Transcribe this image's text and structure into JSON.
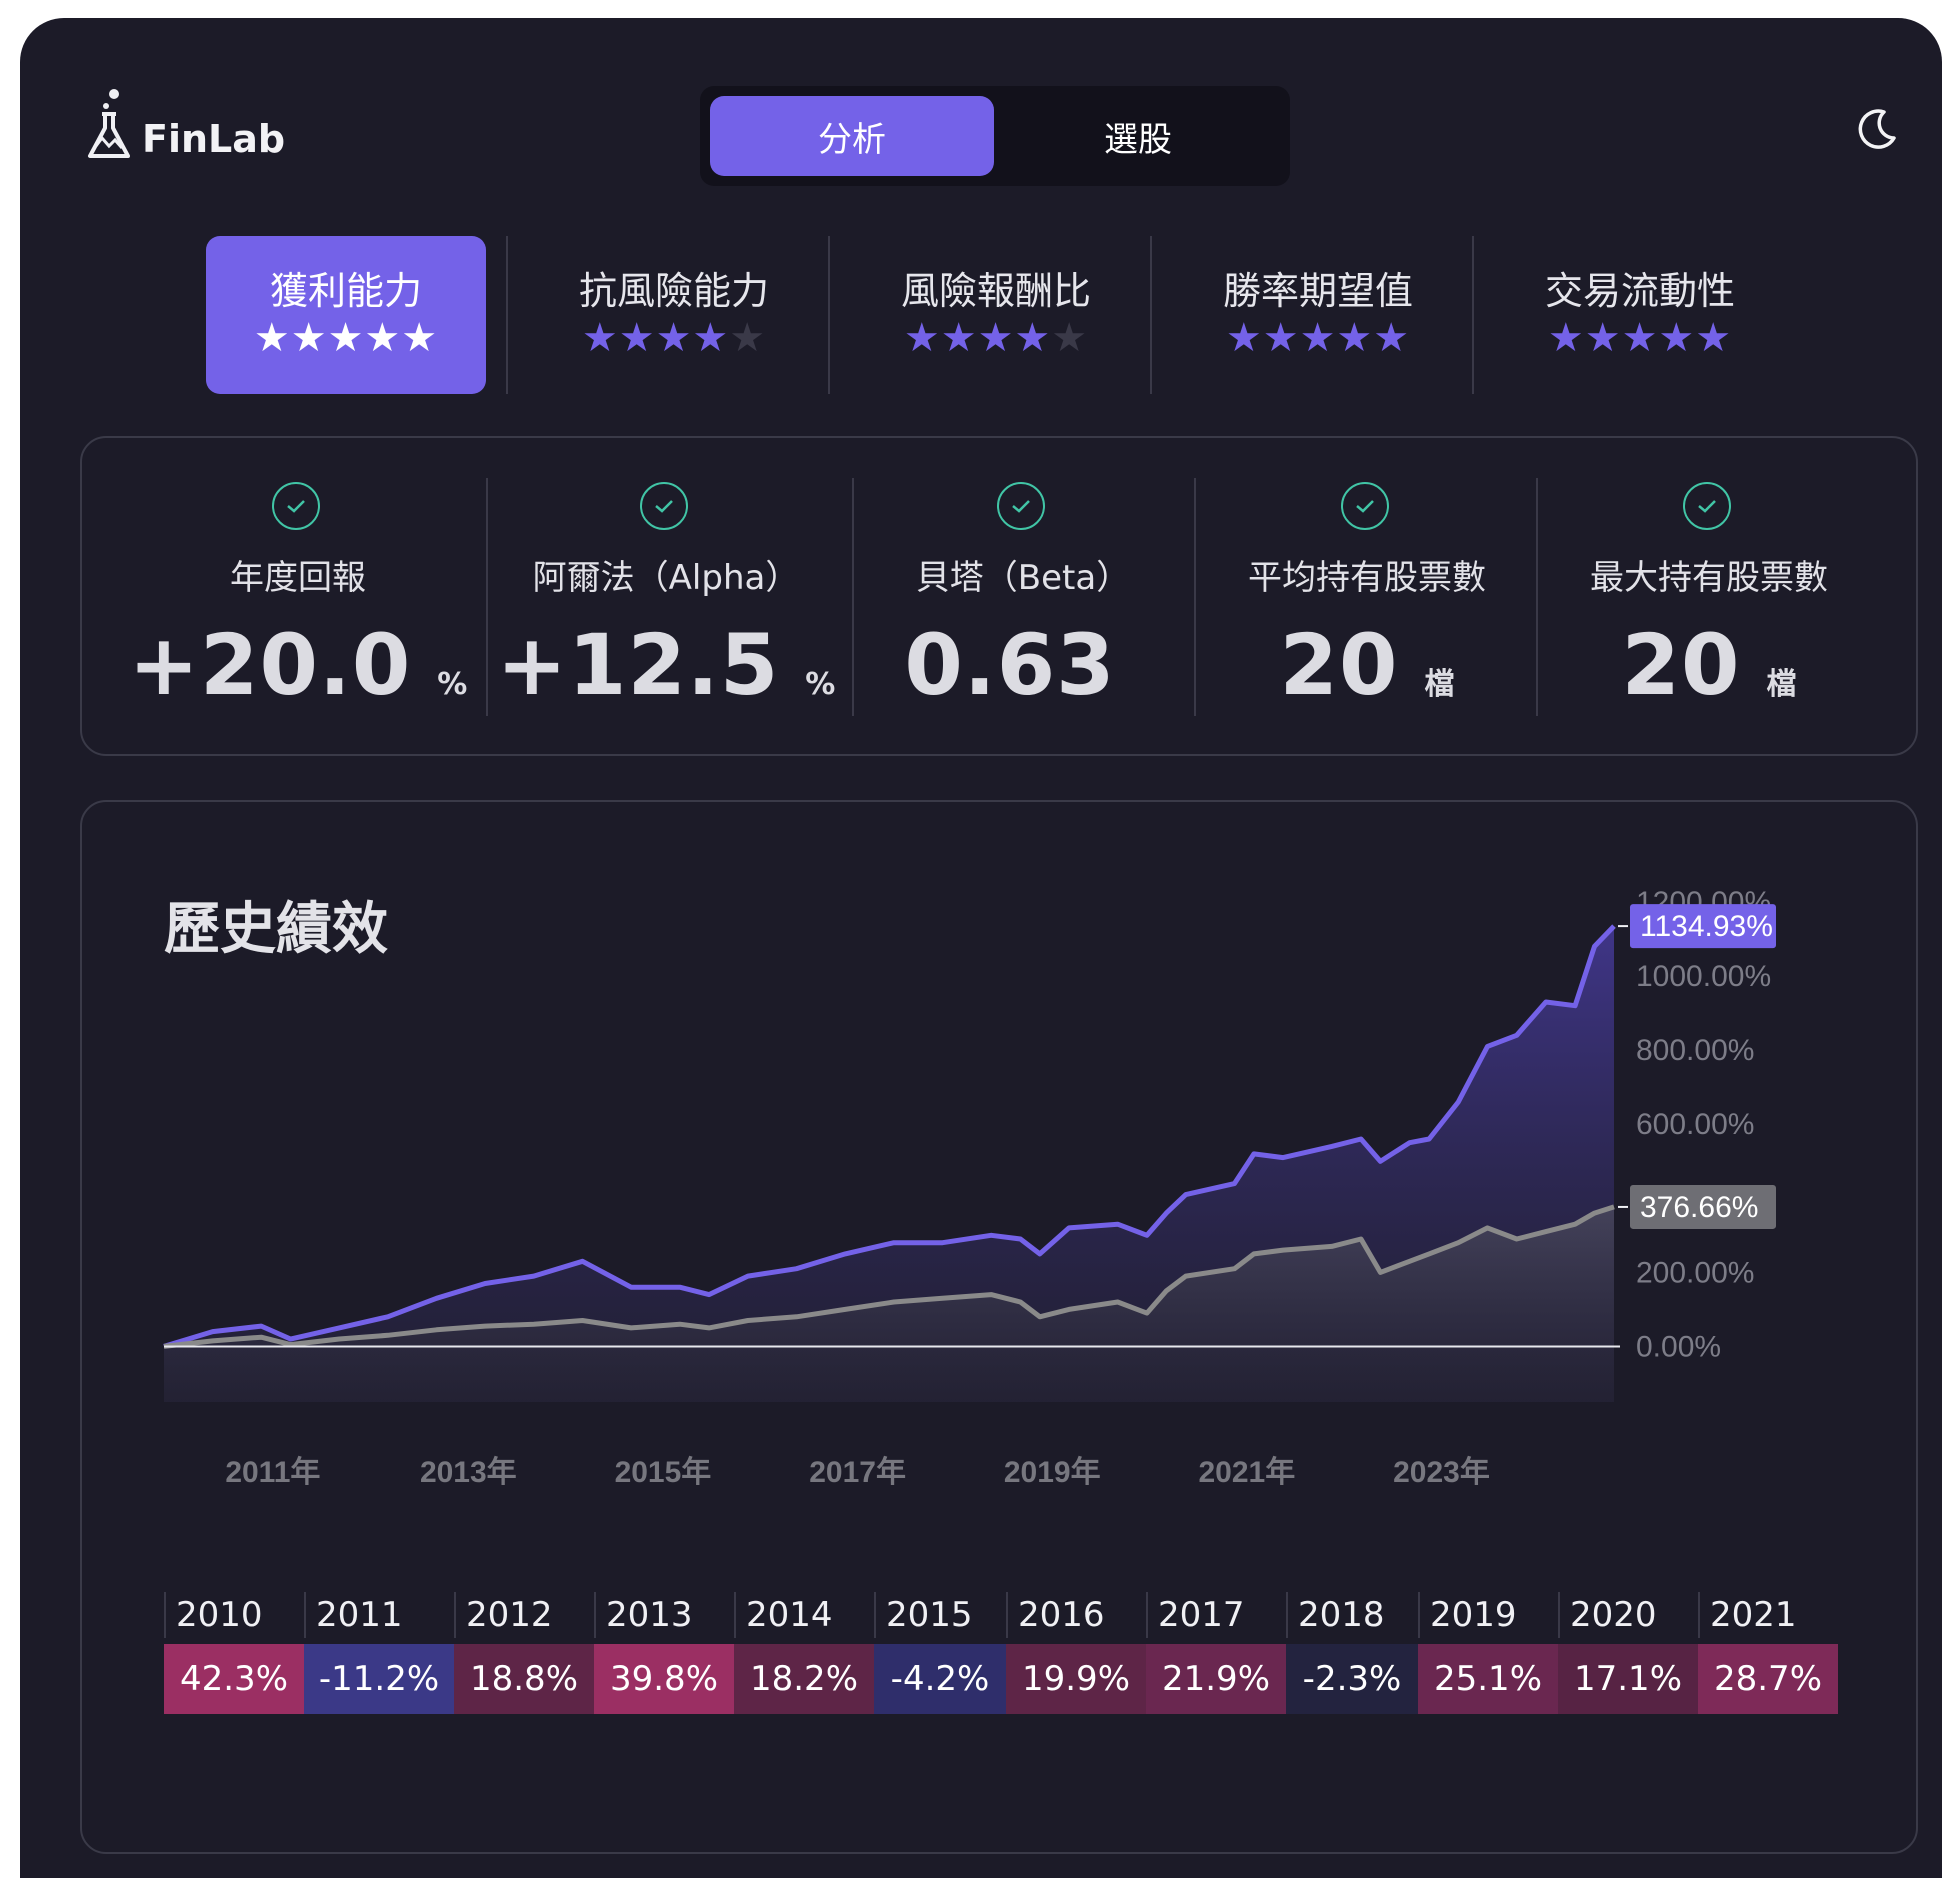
{
  "brand": {
    "name": "FinLab",
    "logo_icon": "flask-icon"
  },
  "mode_tabs": [
    {
      "label": "分析",
      "active": true
    },
    {
      "label": "選股",
      "active": false
    }
  ],
  "theme_toggle_icon": "moon-icon",
  "rating_tabs": [
    {
      "label": "獲利能力",
      "stars": 5,
      "active": true
    },
    {
      "label": "抗風險能力",
      "stars": 4,
      "active": false
    },
    {
      "label": "風險報酬比",
      "stars": 4,
      "active": false
    },
    {
      "label": "勝率期望值",
      "stars": 5,
      "active": false
    },
    {
      "label": "交易流動性",
      "stars": 5,
      "active": false
    }
  ],
  "metrics": [
    {
      "label": "年度回報",
      "value": "+20.0",
      "unit": "%",
      "status_icon": "check-circle-icon"
    },
    {
      "label": "阿爾法（Alpha）",
      "value": "+12.5",
      "unit": "%",
      "status_icon": "check-circle-icon"
    },
    {
      "label": "貝塔（Beta）",
      "value": "0.63",
      "unit": "",
      "status_icon": "check-circle-icon"
    },
    {
      "label": "平均持有股票數",
      "value": "20",
      "unit": "檔",
      "status_icon": "check-circle-icon"
    },
    {
      "label": "最大持有股票數",
      "value": "20",
      "unit": "檔",
      "status_icon": "check-circle-icon"
    }
  ],
  "history": {
    "title": "歷史績效",
    "colors": {
      "strategy": "#7462e8",
      "benchmark": "#8a8a8a",
      "positive": "#9b2f63",
      "negative": "#3a3a8a"
    }
  },
  "chart_data": {
    "type": "area",
    "x_tick_labels": [
      "2011年",
      "2013年",
      "2015年",
      "2017年",
      "2019年",
      "2021年",
      "2023年"
    ],
    "y_tick_labels": [
      "1200.00%",
      "1000.00%",
      "800.00%",
      "600.00%",
      "200.00%",
      "0.00%"
    ],
    "ylim": [
      -150,
      1200
    ],
    "series": [
      {
        "last_value_label": "1134.93%",
        "x": [
          2010.0,
          2010.5,
          2011.0,
          2011.3,
          2011.8,
          2012.3,
          2012.8,
          2013.3,
          2013.8,
          2014.3,
          2014.8,
          2015.3,
          2015.6,
          2016.0,
          2016.5,
          2017.0,
          2017.5,
          2018.0,
          2018.5,
          2018.8,
          2019.0,
          2019.3,
          2019.8,
          2020.1,
          2020.3,
          2020.5,
          2021.0,
          2021.2,
          2021.5,
          2022.0,
          2022.3,
          2022.5,
          2022.8,
          2023.0,
          2023.3,
          2023.6,
          2023.9,
          2024.2,
          2024.5,
          2024.7,
          2024.9
        ],
        "values": [
          0,
          40,
          55,
          20,
          50,
          80,
          130,
          170,
          190,
          230,
          160,
          160,
          140,
          190,
          210,
          250,
          280,
          280,
          300,
          290,
          250,
          320,
          330,
          300,
          360,
          410,
          440,
          520,
          510,
          540,
          560,
          500,
          550,
          560,
          660,
          810,
          840,
          930,
          920,
          1080,
          1134.93
        ]
      },
      {
        "last_value_label": "376.66%",
        "x": [
          2010.0,
          2010.5,
          2011.0,
          2011.3,
          2011.8,
          2012.3,
          2012.8,
          2013.3,
          2013.8,
          2014.3,
          2014.8,
          2015.3,
          2015.6,
          2016.0,
          2016.5,
          2017.0,
          2017.5,
          2018.0,
          2018.5,
          2018.8,
          2019.0,
          2019.3,
          2019.8,
          2020.1,
          2020.3,
          2020.5,
          2021.0,
          2021.2,
          2021.5,
          2022.0,
          2022.3,
          2022.5,
          2022.8,
          2023.0,
          2023.3,
          2023.6,
          2023.9,
          2024.2,
          2024.5,
          2024.7,
          2024.9
        ],
        "values": [
          0,
          15,
          25,
          5,
          20,
          30,
          45,
          55,
          60,
          70,
          50,
          60,
          50,
          70,
          80,
          100,
          120,
          130,
          140,
          120,
          80,
          100,
          120,
          90,
          150,
          190,
          210,
          250,
          260,
          270,
          290,
          200,
          230,
          250,
          280,
          320,
          290,
          310,
          330,
          360,
          376.66
        ]
      }
    ],
    "yearly_returns": {
      "years": [
        "2010",
        "2011",
        "2012",
        "2013",
        "2014",
        "2015",
        "2016",
        "2017",
        "2018",
        "2019",
        "2020",
        "2021"
      ],
      "values": [
        "42.3%",
        "-11.2%",
        "18.8%",
        "39.8%",
        "18.2%",
        "-4.2%",
        "19.9%",
        "21.9%",
        "-2.3%",
        "25.1%",
        "17.1%",
        "28.7%"
      ],
      "cell_colors": [
        "#9b2f63",
        "#3b3987",
        "#5e2547",
        "#9b2f63",
        "#5e2547",
        "#2f2e6b",
        "#5e2547",
        "#6a2750",
        "#23233f",
        "#6a2750",
        "#572344",
        "#7e2a58"
      ]
    }
  }
}
